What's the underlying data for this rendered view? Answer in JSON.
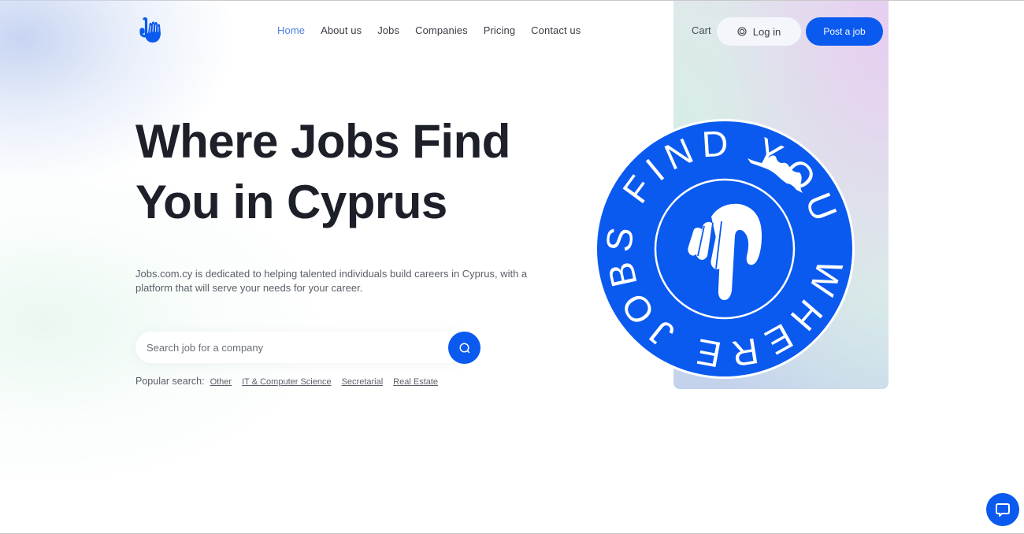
{
  "brand": {
    "logo_icon": "pointing-hand-icon",
    "accent_color": "#0a5af0"
  },
  "nav": {
    "items": [
      {
        "label": "Home",
        "active": true
      },
      {
        "label": "About us",
        "active": false
      },
      {
        "label": "Jobs",
        "active": false
      },
      {
        "label": "Companies",
        "active": false
      },
      {
        "label": "Pricing",
        "active": false
      },
      {
        "label": "Contact us",
        "active": false
      }
    ],
    "active_color": "#4f7fe0"
  },
  "header_actions": {
    "cart_label": "Cart",
    "login_label": "Log in",
    "login_icon": "user-circle-icon",
    "post_job_label": "Post a job"
  },
  "hero": {
    "title_line1": "Where Jobs Find",
    "title_line2": "You in Cyprus",
    "description": "Jobs.com.cy is dedicated to helping talented individuals build careers in Cyprus, with a platform that will serve your needs for your career.",
    "search": {
      "placeholder": "Search job for a company",
      "value": "",
      "button_icon": "search-icon"
    },
    "popular": {
      "label": "Popular search:",
      "links": [
        "Other",
        "IT & Computer Science",
        "Secretarial",
        "Real Estate"
      ]
    }
  },
  "badge": {
    "ring_text": "WHERE JOBS FIND YOU",
    "center_icon": "pointing-hand-icon",
    "decor_icon": "cyprus-map-icon",
    "color": "#0a5af0"
  },
  "chat": {
    "icon": "chat-bubble-icon"
  }
}
